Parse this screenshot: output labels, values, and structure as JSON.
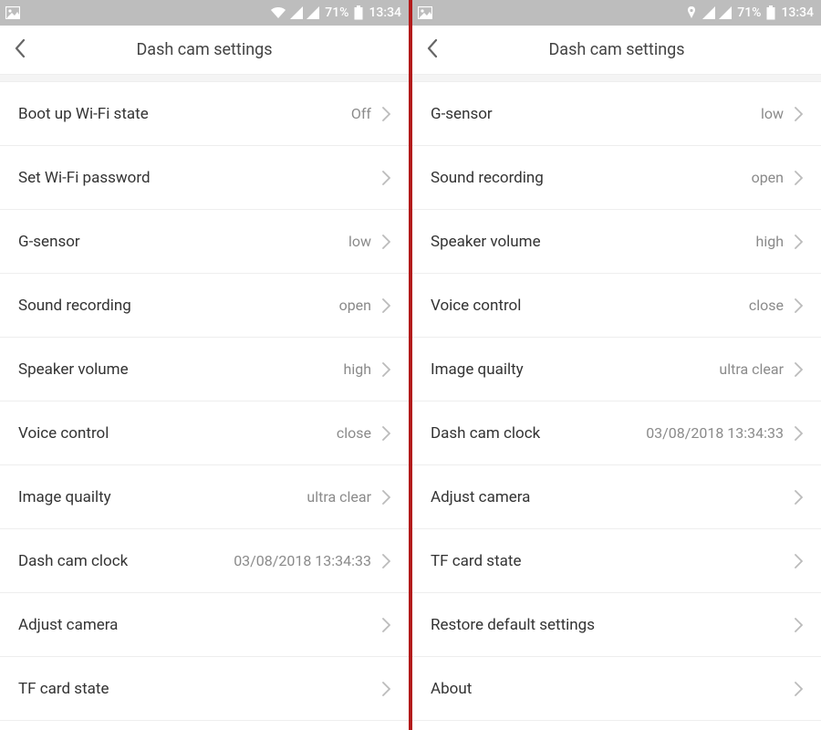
{
  "status": {
    "battery_pct": "71%",
    "time": "13:34"
  },
  "left": {
    "title": "Dash cam settings",
    "items": [
      {
        "label": "Boot up Wi-Fi state",
        "value": "Off"
      },
      {
        "label": "Set Wi-Fi password",
        "value": ""
      },
      {
        "label": "G-sensor",
        "value": "low"
      },
      {
        "label": "Sound recording",
        "value": "open"
      },
      {
        "label": "Speaker volume",
        "value": "high"
      },
      {
        "label": "Voice control",
        "value": "close"
      },
      {
        "label": "Image quailty",
        "value": "ultra clear"
      },
      {
        "label": "Dash cam clock",
        "value": "03/08/2018 13:34:33"
      },
      {
        "label": "Adjust camera",
        "value": ""
      },
      {
        "label": "TF card state",
        "value": ""
      }
    ]
  },
  "right": {
    "title": "Dash cam settings",
    "items": [
      {
        "label": "G-sensor",
        "value": "low"
      },
      {
        "label": "Sound recording",
        "value": "open"
      },
      {
        "label": "Speaker volume",
        "value": "high"
      },
      {
        "label": "Voice control",
        "value": "close"
      },
      {
        "label": "Image quailty",
        "value": "ultra clear"
      },
      {
        "label": "Dash cam clock",
        "value": "03/08/2018 13:34:33"
      },
      {
        "label": "Adjust camera",
        "value": ""
      },
      {
        "label": "TF card state",
        "value": ""
      },
      {
        "label": "Restore default settings",
        "value": ""
      },
      {
        "label": "About",
        "value": ""
      }
    ]
  }
}
